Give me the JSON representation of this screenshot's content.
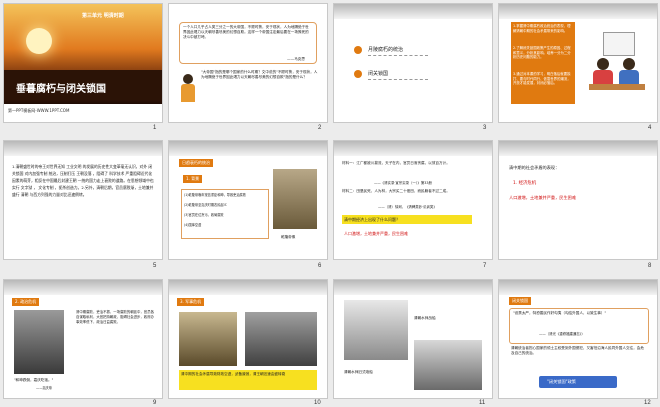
{
  "slides": [
    {
      "num": "1",
      "unit": "第三单元  明清时期",
      "title": "垂暮腐朽与闭关锁国",
      "footer": "第一PPT模板网-WWW.1PPT.COM"
    },
    {
      "num": "2",
      "quote": "一个人口几乎占人类三分之一的大帝国，不顾时势，安于现状，人为地隔绝于世界因此竭力以天朝尽善尽美的幻想自欺。这样一个帝国注定最后要在一场殊死的决斗中被打垮。",
      "quote_author": "——马克思",
      "question": "\"大帝国\"指的是哪个国家的什么时期？文中说的\"不顾时势，安于现状，人为地隔绝于世界因此竭力以天朝尽善尽美的幻想自欺\"指的是什么？"
    },
    {
      "num": "3",
      "item1": "月陵腐朽的统治",
      "item2": "闭关锁国"
    },
    {
      "num": "4",
      "goals": [
        "1.掌握清中期腐朽政治统治的表现，理解清朝中期的社会矛盾带来的影响。",
        "2.了解闭关锁国政策产生的原因、过程和意义，分析其影响。培养一分为二分析历史问题的能力。",
        "3.通过对本课的学习，明白落后就要挨打、要与时代同行、依靠世界的潮流，开放才能发展，封闭必落后。"
      ]
    },
    {
      "num": "5",
      "text": "1.清朝盛世时的帝王对世界无知  工业文明  的发展的历史性大变革毫无认识，对外  闭关锁国  对内加强专制  统治，压制打压  王朝没落  ，阻碍了  科学技术  严重阻碍近代化因素的萌芽，相反在中国最后封建王朝  一统的国力走上衰败的道路。在思想领域中也实行  文字狱  ，  文化专制  ，扼杀创造力。2.另外，清朝后期，官员腐败渐，土地兼并盛行  清朝  与西方列强的力量对比迅速倒转。"
    },
    {
      "num": "6",
      "tag": "日趋衰朽的统治",
      "sub": "1. 背景",
      "lines": [
        "(1)乾隆帝晚年宠信重臣和珅，导致吏治腐败",
        "(2)乾隆帝至嘉庆时期农民起义",
        "(3)官员在位贪污，政局腐败",
        "(4)国库空虚"
      ],
      "caption": "乾隆帝像"
    },
    {
      "num": "7",
      "mat1": "材料一：江广都被川蔓流，天子在内，官员日渐贪腐，以敛百万计。",
      "src1": "——《清实录·宣宗实录（一）》第33册",
      "mat2": "材料二：田垦民死，人为林，大宗买二十佃田，而民躲者不过二成。",
      "src2": "——（清）徐珂，《清稗类钞·讥讽类》",
      "q": "清中期经济上出现了什么问题？",
      "a": "人口激增，土地兼并严重，民生困难"
    },
    {
      "num": "8",
      "head": "清中期的社会矛盾的表现：",
      "sub": "1. 经济危机",
      "body": "人口激增，土地兼并严重，民生困难"
    },
    {
      "num": "9",
      "tag": "2. 政治危机",
      "body": "清中期腐败，吏治不振，一场腐败的朝廷中，官员各自谋取私利，大官把持朝政，阻碍社会进步，政府办事效率低下，政治日益腐败。",
      "quote": "\"和珅跌倒，嘉庆吃饱。\"",
      "cap": "——嘉庆帝"
    },
    {
      "num": "10",
      "tag": "3. 军事危机",
      "body": "清中期的社会矛盾导致财政空虚，武备废弛，清王朝迅速由盛转衰"
    },
    {
      "num": "11",
      "cap1": "清朝水师战船",
      "cap2": "清朝水师旧式炮船"
    },
    {
      "num": "12",
      "tag": "闭关锁国",
      "quote": "\"设禁太严，特恐善民作奸勾夷（勾结外国人，以致生事）\"",
      "src": "——（清光《重修福建通志》）",
      "body": "清朝统治者担心国家的领土主权受到外国侵犯，又害怕沿海人民同外国人交往，会危及自己的统治。",
      "box": "\"闭关锁国\"政策"
    }
  ],
  "colors": {
    "orange": "#e07a10",
    "red": "#d01010",
    "border": "#e0a060"
  }
}
